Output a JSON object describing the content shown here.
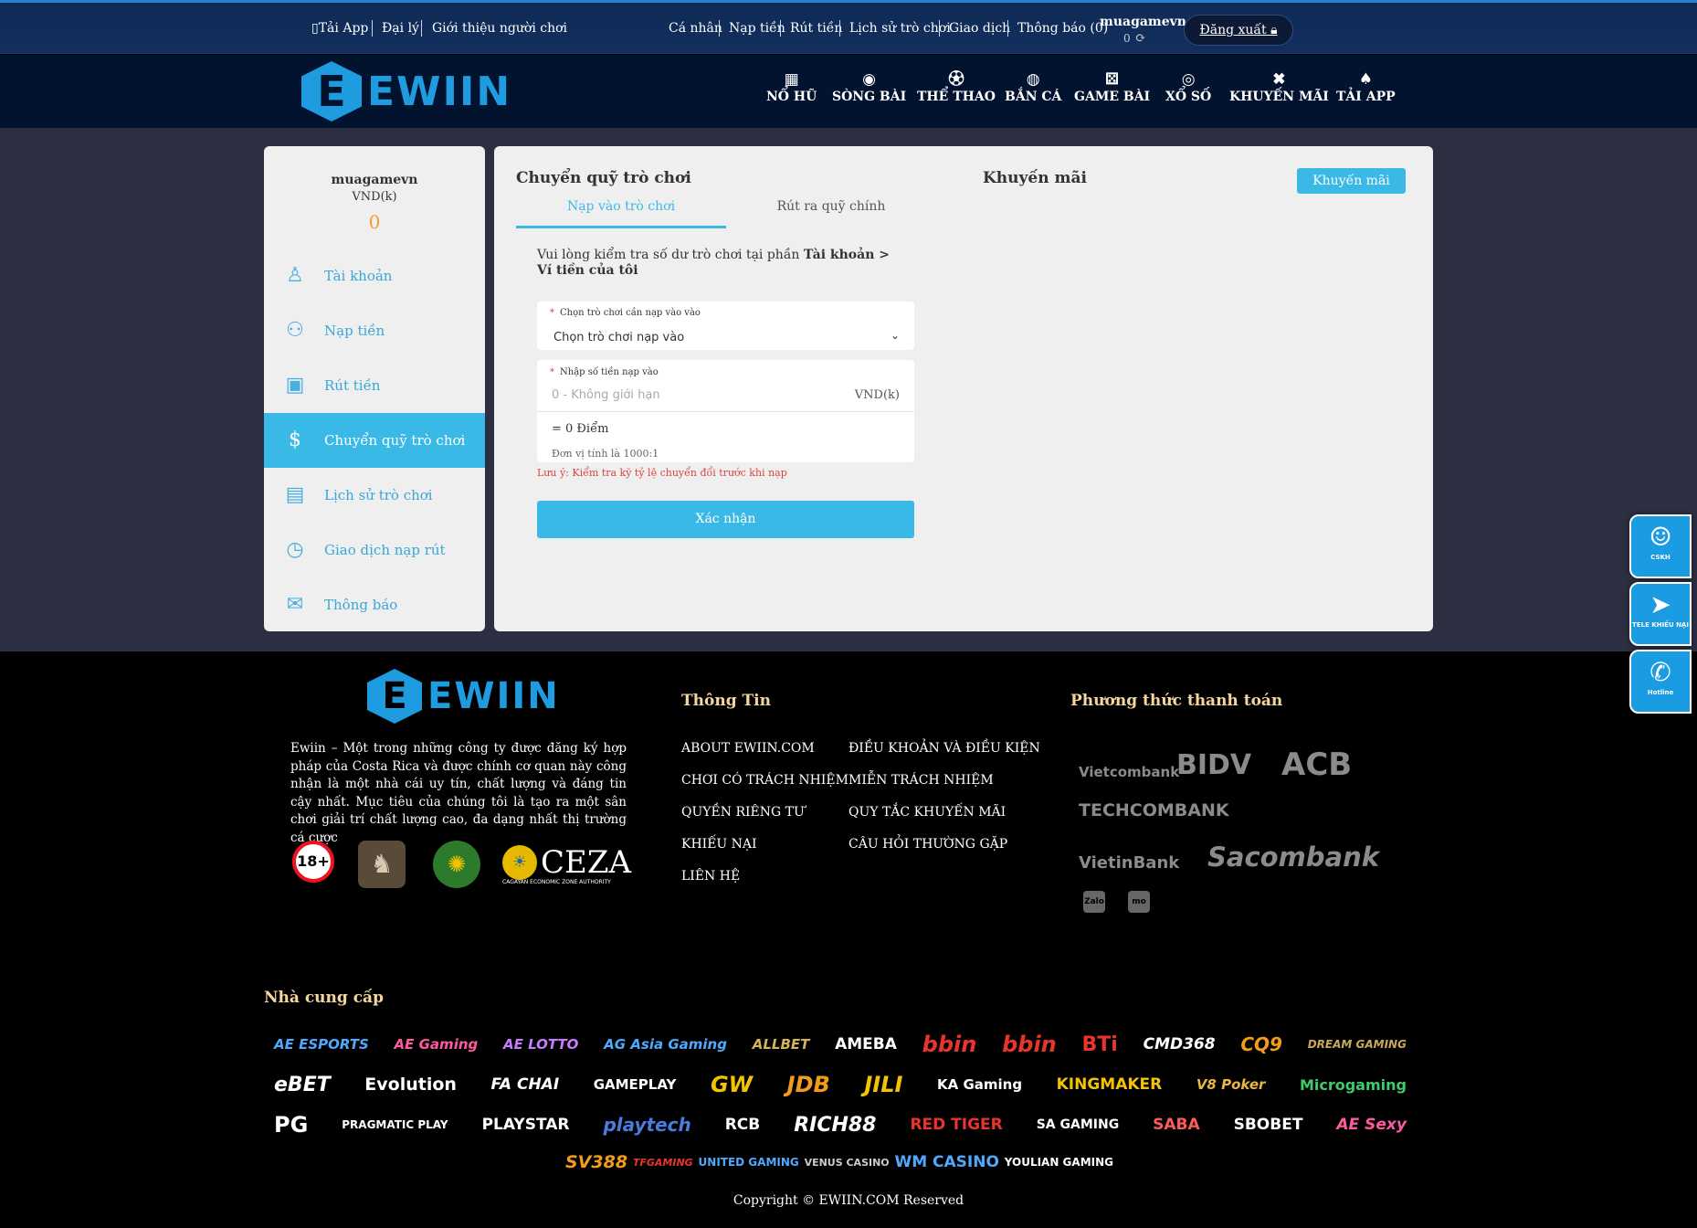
{
  "topbar": {
    "left_links": [
      "Tải App",
      "Đại lý",
      "Giới thiệu người chơi"
    ],
    "right_links": [
      "Cá nhân",
      "Nạp tiền",
      "Rút tiền",
      "Lịch sử trò chơi",
      "Giao dịch",
      "Thông báo (0)"
    ],
    "username": "muagamevn",
    "balance": "0",
    "logout_label": "Đăng xuất"
  },
  "brand": {
    "letter": "E",
    "word": "EWIIN"
  },
  "nav": [
    {
      "label": "NỔ HŨ",
      "icon": "slot-icon"
    },
    {
      "label": "SÒNG BÀI",
      "icon": "casino-chip-icon"
    },
    {
      "label": "THỂ THAO",
      "icon": "soccer-ball-icon"
    },
    {
      "label": "BẮN CÁ",
      "icon": "fish-icon"
    },
    {
      "label": "GAME BÀI",
      "icon": "dice-icon"
    },
    {
      "label": "XỔ SỐ",
      "icon": "lottery-ball-icon"
    },
    {
      "label": "KHUYẾN MÃI",
      "icon": "ticket-icon"
    },
    {
      "label": "TẢI APP",
      "icon": "spade-icon"
    }
  ],
  "sidebar": {
    "username": "muagamevn",
    "currency": "VND(k)",
    "balance": "0",
    "items": [
      {
        "label": "Tài khoản",
        "icon": "user-icon"
      },
      {
        "label": "Nạp tiền",
        "icon": "deposit-icon"
      },
      {
        "label": "Rút tiền",
        "icon": "withdraw-icon"
      },
      {
        "label": "Chuyển quỹ trò chơi",
        "icon": "dollar-circle-icon"
      },
      {
        "label": "Lịch sử trò chơi",
        "icon": "history-doc-icon"
      },
      {
        "label": "Giao dịch nạp rút",
        "icon": "clock-icon"
      },
      {
        "label": "Thông báo",
        "icon": "mail-icon"
      }
    ]
  },
  "panel": {
    "title": "Chuyển quỹ trò chơi",
    "tabs": [
      "Nạp vào trò chơi",
      "Rút ra quỹ chính"
    ],
    "promo_title": "Khuyến mãi",
    "promo_button": "Khuyến mãi",
    "info_prefix": "Vui lòng kiểm tra số dư trò chơi tại phần ",
    "info_bold": "Tài khoản > Ví tiền của tôi",
    "select_label": "Chọn trò chơi cần nạp vào vào",
    "select_value": "Chọn trò chơi nạp vào",
    "amount_label": "Nhập số tiền nạp vào",
    "amount_placeholder": "0 - Không giới hạn",
    "amount_unit": "VND(k)",
    "points": "= 0 Điểm",
    "rate": "Đơn vị tính là 1000:1",
    "note": "Lưu ý: Kiểm tra kỹ tỷ lệ chuyển đổi trước khi nạp",
    "confirm": "Xác nhận"
  },
  "floating": [
    {
      "label": "CSKH",
      "icon": "support-icon"
    },
    {
      "label": "TELE KHIẾU NẠI",
      "icon": "telegram-icon"
    },
    {
      "label": "Hotline",
      "icon": "phone-icon"
    }
  ],
  "footer": {
    "description": "Ewiin – Một trong những công ty được đăng ký hợp pháp của Costa Rica và được chính cơ quan này công nhận là một nhà cái uy tín, chất lượng và đáng tin cậy nhất. Mục tiêu của chúng tôi là tạo ra một sân chơi giải trí chất lượng cao, đa dạng nhất thị trường cá cược",
    "badge_18": "18+",
    "ceza": "CEZA",
    "ceza_sub": "CAGAYAN ECONOMIC ZONE AUTHORITY",
    "info_heading": "Thông Tin",
    "links_col1": [
      "ABOUT EWIIN.COM",
      "CHƠI CÓ TRÁCH NHIỆM",
      "QUYỀN RIÊNG TƯ",
      "KHIẾU NẠI",
      "LIÊN HỆ"
    ],
    "links_col2": [
      "ĐIỀU KHOẢN VÀ ĐIỀU KIỆN",
      "MIỄN TRÁCH NHIỆM",
      "QUY TẮC KHUYẾN MÃI",
      "CÂU HỎI THƯỜNG GẶP"
    ],
    "payment_heading": "Phương thức thanh toán",
    "banks": [
      "Vietcombank",
      "BIDV",
      "ACB",
      "TECHCOMBANK",
      "VietinBank",
      "Sacombank"
    ],
    "wallets": [
      "Zalo Pay",
      "mo mo"
    ],
    "providers_heading": "Nhà cung cấp",
    "providers": [
      [
        "AE ESPORTS",
        "AE Gaming",
        "AE LOTTO",
        "AG Asia Gaming",
        "ALLBET",
        "AMEBA",
        "bbin",
        "bbin",
        "BTi",
        "CMD368",
        "CQ9",
        "DREAM GAMING"
      ],
      [
        "eBET",
        "Evolution",
        "FA CHAI",
        "GAMEPLAY",
        "GW",
        "JDB",
        "JILI",
        "KA Gaming",
        "KINGMAKER",
        "V8 Poker",
        "Microgaming"
      ],
      [
        "PG",
        "PRAGMATIC PLAY",
        "PLAYSTAR",
        "playtech",
        "RCB",
        "RICH88",
        "RED TIGER",
        "SA GAMING",
        "SABA",
        "SBOBET",
        "AE Sexy"
      ],
      [
        "SV388",
        "TFGAMING",
        "UNITED GAMING",
        "VENUS CASINO",
        "WM CASINO",
        "YOULIAN GAMING"
      ]
    ],
    "copyright": "Copyright © EWIIN.COM Reserved"
  }
}
